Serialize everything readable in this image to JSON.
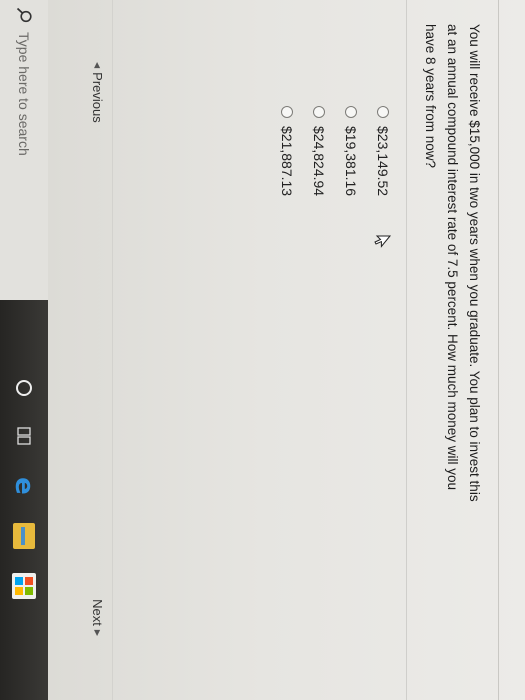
{
  "question": {
    "line1": "You will receive $15,000 in two years when you graduate. You plan to invest this",
    "line2": "at an annual compound interest rate of 7.5 percent. How much money will you",
    "line3": "have 8 years from now?"
  },
  "choices": [
    {
      "label": "$23,149.52"
    },
    {
      "label": "$19,381.16"
    },
    {
      "label": "$24,824.94"
    },
    {
      "label": "$21,887.13"
    }
  ],
  "nav": {
    "previous_label": "Previous",
    "next_label": "Next"
  },
  "taskbar": {
    "search_placeholder": "Type here to search"
  }
}
